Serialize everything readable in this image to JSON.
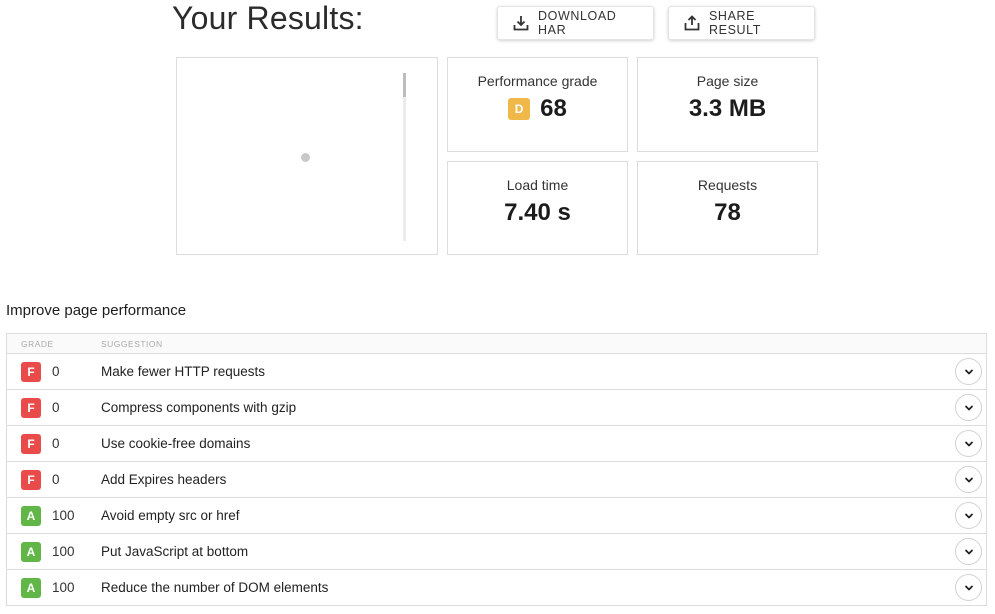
{
  "header": {
    "title": "Your Results:",
    "download_har_label": "DOWNLOAD HAR",
    "share_result_label": "SHARE RESULT"
  },
  "metrics": {
    "performance_grade": {
      "label": "Performance grade",
      "letter": "D",
      "value": "68",
      "color": "#f0b849"
    },
    "page_size": {
      "label": "Page size",
      "value": "3.3 MB"
    },
    "load_time": {
      "label": "Load time",
      "value": "7.40 s"
    },
    "requests": {
      "label": "Requests",
      "value": "78"
    }
  },
  "improve": {
    "title": "Improve page performance",
    "columns": {
      "grade": "GRADE",
      "suggestion": "SUGGESTION"
    },
    "rows": [
      {
        "letter": "F",
        "score": "0",
        "suggestion": "Make fewer HTTP requests",
        "color": "#e94b4b"
      },
      {
        "letter": "F",
        "score": "0",
        "suggestion": "Compress components with gzip",
        "color": "#e94b4b"
      },
      {
        "letter": "F",
        "score": "0",
        "suggestion": "Use cookie-free domains",
        "color": "#e94b4b"
      },
      {
        "letter": "F",
        "score": "0",
        "suggestion": "Add Expires headers",
        "color": "#e94b4b"
      },
      {
        "letter": "A",
        "score": "100",
        "suggestion": "Avoid empty src or href",
        "color": "#62b547"
      },
      {
        "letter": "A",
        "score": "100",
        "suggestion": "Put JavaScript at bottom",
        "color": "#62b547"
      },
      {
        "letter": "A",
        "score": "100",
        "suggestion": "Reduce the number of DOM elements",
        "color": "#62b547"
      }
    ]
  },
  "icons": {
    "download": "download-icon",
    "share": "share-icon",
    "expand": "chevron-down-icon"
  }
}
